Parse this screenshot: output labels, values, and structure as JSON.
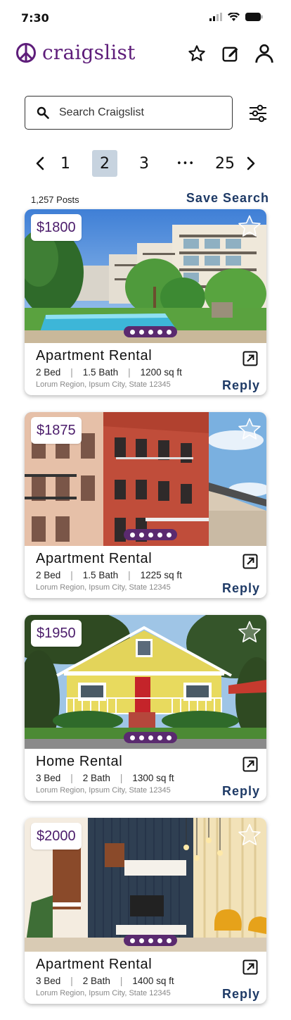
{
  "status_bar": {
    "time": "7:30"
  },
  "app": {
    "name": "craigslist",
    "brand_color": "#5e1d7a"
  },
  "search": {
    "placeholder": "Search Craigslist",
    "value": ""
  },
  "pagination": {
    "pages": [
      "1",
      "2",
      "3",
      "•••",
      "25"
    ],
    "current": "2"
  },
  "listing_summary": {
    "posts_count": "1,257 Posts",
    "save_search_label": "Save Search"
  },
  "listings": [
    {
      "price": "$1800",
      "title": "Apartment Rental",
      "beds": "2 Bed",
      "baths": "1.5 Bath",
      "sqft": "1200 sq ft",
      "address": "Lorum Region, Ipsum City, State 12345",
      "reply": "Reply",
      "photo": "apartment-pool-building"
    },
    {
      "price": "$1875",
      "title": "Apartment Rental",
      "beds": "2 Bed",
      "baths": "1.5 Bath",
      "sqft": "1225 sq ft",
      "address": "Lorum Region, Ipsum City, State 12345",
      "reply": "Reply",
      "photo": "brick-apartment-buildings"
    },
    {
      "price": "$1950",
      "title": "Home Rental",
      "beds": "3 Bed",
      "baths": "2 Bath",
      "sqft": "1300 sq ft",
      "address": "Lorum Region, Ipsum City, State 12345",
      "reply": "Reply",
      "photo": "yellow-house"
    },
    {
      "price": "$2000",
      "title": "Apartment Rental",
      "beds": "3 Bed",
      "baths": "2 Bath",
      "sqft": "1400 sq ft",
      "address": "Lorum Region, Ipsum City, State 12345",
      "reply": "Reply",
      "photo": "modern-living-room"
    }
  ]
}
